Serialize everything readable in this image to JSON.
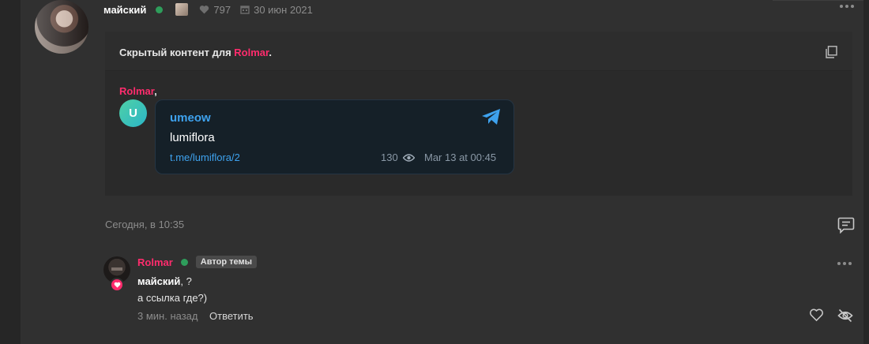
{
  "post": {
    "author": "майский",
    "likes": "797",
    "date": "30 июн 2021",
    "hidden_content": {
      "title_prefix": "Скрытый контент для ",
      "title_user": "Rolmar",
      "title_suffix": ".",
      "mention_user": "Rolmar",
      "mention_suffix": ","
    },
    "telegram_card": {
      "avatar_letter": "U",
      "channel": "umeow",
      "text": "lumiflora",
      "link": "t.me/lumiflora/2",
      "views": "130",
      "date": "Mar 13 at 00:45"
    },
    "timestamp": "Сегодня, в 10:35"
  },
  "comment": {
    "author": "Rolmar",
    "badge": "Автор темы",
    "mention": "майский",
    "mention_rest": ", ?",
    "text": "а ссылка где?)",
    "time": "3 мин. назад",
    "reply_label": "Ответить"
  },
  "colors": {
    "accent_pink": "#ff2c6d",
    "online_green": "#2e9d5b",
    "telegram_blue": "#3ea2ee"
  }
}
